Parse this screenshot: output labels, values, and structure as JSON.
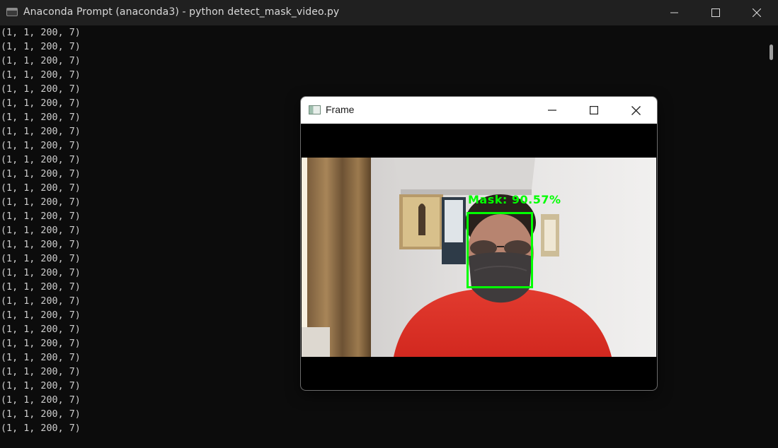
{
  "window": {
    "title": "Anaconda Prompt (anaconda3) - python  detect_mask_video.py"
  },
  "console": {
    "lines": [
      "(1, 1, 200, 7)",
      "(1, 1, 200, 7)",
      "(1, 1, 200, 7)",
      "(1, 1, 200, 7)",
      "(1, 1, 200, 7)",
      "(1, 1, 200, 7)",
      "(1, 1, 200, 7)",
      "(1, 1, 200, 7)",
      "(1, 1, 200, 7)",
      "(1, 1, 200, 7)",
      "(1, 1, 200, 7)",
      "(1, 1, 200, 7)",
      "(1, 1, 200, 7)",
      "(1, 1, 200, 7)",
      "(1, 1, 200, 7)",
      "(1, 1, 200, 7)",
      "(1, 1, 200, 7)",
      "(1, 1, 200, 7)",
      "(1, 1, 200, 7)",
      "(1, 1, 200, 7)",
      "(1, 1, 200, 7)",
      "(1, 1, 200, 7)",
      "(1, 1, 200, 7)",
      "(1, 1, 200, 7)",
      "(1, 1, 200, 7)",
      "(1, 1, 200, 7)",
      "(1, 1, 200, 7)",
      "(1, 1, 200, 7)",
      "(1, 1, 200, 7)"
    ]
  },
  "frame": {
    "title": "Frame",
    "detection": {
      "label": "Mask: 90.57%",
      "color": "#00ff00"
    }
  },
  "icons": {
    "terminal": "terminal-icon",
    "frame": "image-window-icon",
    "minimize": "minimize-icon",
    "maximize": "maximize-icon",
    "close": "close-icon"
  }
}
